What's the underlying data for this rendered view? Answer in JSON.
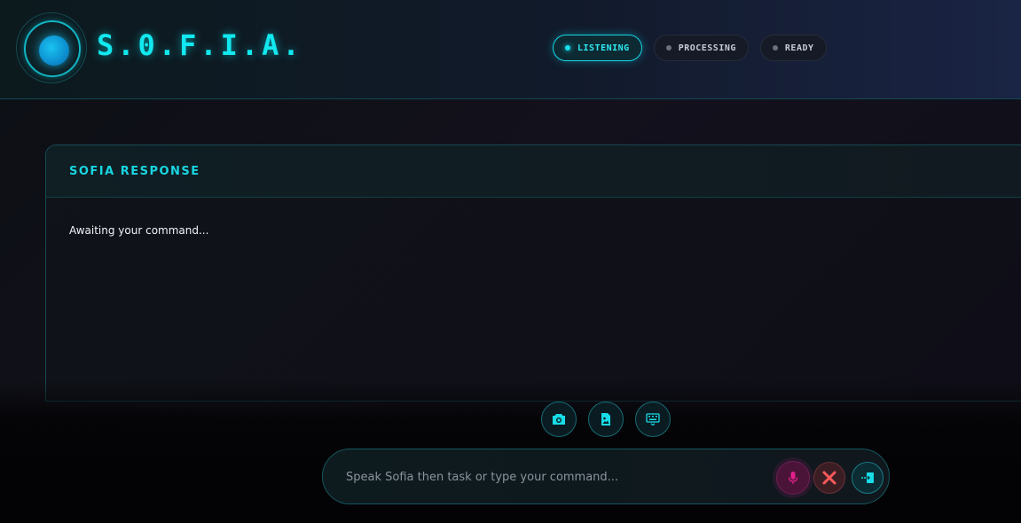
{
  "app": {
    "brand": "S.0.F.I.A."
  },
  "status": {
    "items": [
      {
        "label": "LISTENING",
        "active": true
      },
      {
        "label": "PROCESSING",
        "active": false
      },
      {
        "label": "READY",
        "active": false
      }
    ]
  },
  "panel": {
    "title": "SOFIA RESPONSE",
    "body": "Awaiting your command..."
  },
  "tools": {
    "icons": [
      "camera-icon",
      "image-file-icon",
      "keyboard-icon"
    ]
  },
  "input": {
    "placeholder": "Speak Sofia then task or type your command...",
    "value": ""
  },
  "actions": {
    "mic_icon": "microphone-icon",
    "cancel_icon": "close-icon",
    "send_icon": "send-icon"
  },
  "colors": {
    "accent": "#12e8ef",
    "mic": "#e0208a",
    "cancel": "#ff5a5a"
  }
}
